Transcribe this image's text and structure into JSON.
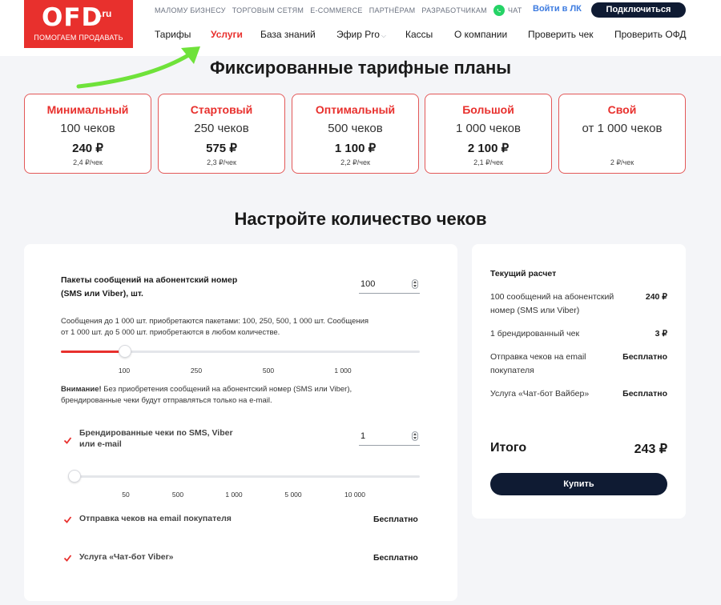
{
  "logo": {
    "main": "OFD",
    "ru": ".ru",
    "slogan": "ПОМОГАЕМ ПРОДАВАТЬ"
  },
  "topnav": {
    "items": [
      "МАЛОМУ БИЗНЕСУ",
      "ТОРГОВЫМ СЕТЯМ",
      "E-COMMERCE",
      "ПАРТНЁРАМ",
      "РАЗРАБОТЧИКАМ"
    ],
    "chat": "ЧАТ",
    "login": "Войти в ЛК",
    "connect": "Подключиться"
  },
  "mainnav": {
    "items": [
      "Тарифы",
      "Услуги",
      "База знаний",
      "Эфир Pro",
      "Кассы",
      "О компании",
      "Проверить чек",
      "Проверить ОФД"
    ],
    "active_index": 1
  },
  "headings": {
    "plans": "Фиксированные тарифные планы",
    "configure": "Настройте количество чеков"
  },
  "plans": [
    {
      "name": "Минимальный",
      "count": "100 чеков",
      "price": "240 ₽",
      "per": "2,4 ₽/чек"
    },
    {
      "name": "Стартовый",
      "count": "250 чеков",
      "price": "575 ₽",
      "per": "2,3 ₽/чек"
    },
    {
      "name": "Оптимальный",
      "count": "500 чеков",
      "price": "1 100 ₽",
      "per": "2,2 ₽/чек"
    },
    {
      "name": "Большой",
      "count": "1 000 чеков",
      "price": "2 100 ₽",
      "per": "2,1 ₽/чек"
    },
    {
      "name": "Свой",
      "count": "от 1 000 чеков",
      "price": "",
      "per": "2 ₽/чек"
    }
  ],
  "config": {
    "sms": {
      "label_line1": "Пакеты сообщений на абонентский номер",
      "label_line2": "(SMS или Viber), шт.",
      "value": "100",
      "info_line1": "Сообщения до 1 000 шт. приобретаются пакетами: 100, 250, 500, 1 000 шт. Сообщения",
      "info_line2": "от 1 000 шт. до 5 000 шт. приобретаются в любом количестве.",
      "slider_fraction": 0.16,
      "ticks": [
        "100",
        "250",
        "500",
        "1 000"
      ]
    },
    "warning": {
      "bold": "Внимание!",
      "line1": " Без приобретения сообщений на абонентский номер (SMS или Viber),",
      "line2": "брендированные чеки будут отправляться только на e-mail."
    },
    "branded": {
      "label_line1": "Брендированные чеки по SMS, Viber",
      "label_line2": "или e-mail",
      "value": "1",
      "slider_fraction": 0.0,
      "ticks": [
        "50",
        "500",
        "1 000",
        "5 000",
        "10 000"
      ]
    },
    "email": {
      "label": "Отправка чеков на email покупателя",
      "price": "Бесплатно"
    },
    "chatbot": {
      "label": "Услуга «Чат-бот Viber»",
      "price": "Бесплатно"
    }
  },
  "summary": {
    "title": "Текущий расчет",
    "rows": [
      {
        "l1": "100 сообщений на абонентский",
        "l2": "номер (SMS или Viber)",
        "value": "240 ₽"
      },
      {
        "l1": "1 брендированный чек",
        "l2": "",
        "value": "3 ₽"
      },
      {
        "l1": "Отправка чеков на email",
        "l2": "покупателя",
        "value": "Бесплатно"
      },
      {
        "l1": "Услуга «Чат-бот Вайбер»",
        "l2": "",
        "value": "Бесплатно"
      }
    ],
    "total_label": "Итого",
    "total_value": "243 ₽",
    "buy": "Купить"
  },
  "colors": {
    "brand_red": "#e8302d",
    "navy": "#0f1b33",
    "link_blue": "#3e7ce0",
    "arrow_green": "#6fe23a"
  }
}
